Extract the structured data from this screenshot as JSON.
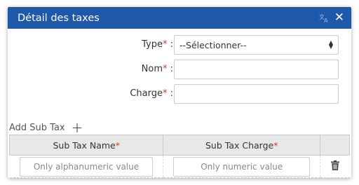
{
  "dialog": {
    "title": "Détail des taxes",
    "close_glyph": "✕"
  },
  "form": {
    "type": {
      "label": "Type",
      "required_mark": "*",
      "colon": " :",
      "value": "--Sélectionner--"
    },
    "nom": {
      "label": "Nom",
      "required_mark": "*",
      "colon": " :",
      "value": ""
    },
    "charge": {
      "label": "Charge",
      "required_mark": "*",
      "colon": " :",
      "value": ""
    }
  },
  "subtax": {
    "add_label": "Add Sub Tax",
    "add_glyph": "+",
    "columns": [
      {
        "label": "Sub Tax Name",
        "required_mark": "*"
      },
      {
        "label": "Sub Tax Charge",
        "required_mark": "*"
      },
      {
        "label": ""
      }
    ],
    "rows": [
      {
        "name_placeholder": "Only alphanumeric value",
        "charge_placeholder": "Only numeric value"
      }
    ]
  },
  "colors": {
    "titlebar": "#1e58a8",
    "required": "#e0322b"
  },
  "icons": {
    "translate": "translate-icon",
    "close": "close-icon",
    "select_arrows": "chevron-updown-icon",
    "add": "plus-icon",
    "delete": "trash-icon"
  }
}
